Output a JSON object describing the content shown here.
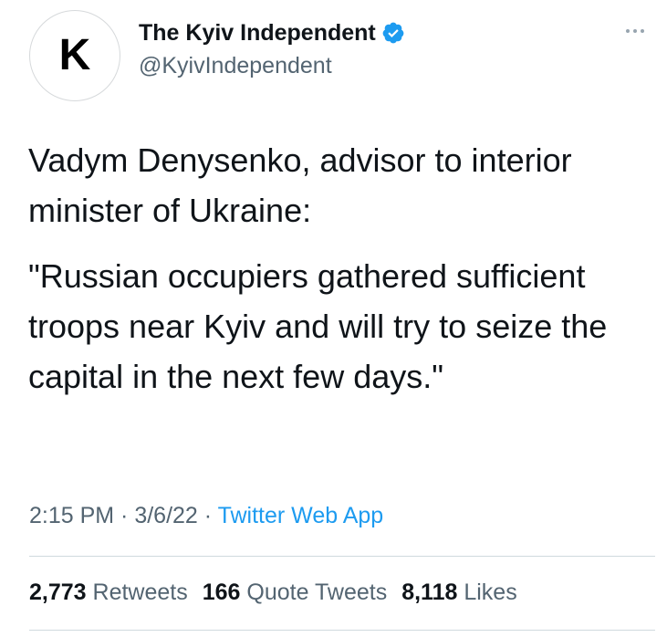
{
  "author": {
    "avatar_letter": "K",
    "display_name": "The Kyiv Independent",
    "verified": true,
    "handle": "@KyivIndependent"
  },
  "menu": {
    "icon": "more-horizontal-icon"
  },
  "tweet": {
    "paragraphs": [
      "Vadym Denysenko, advisor to interior minister of Ukraine:",
      "\"Russian occupiers gathered sufficient troops near Kyiv and will try to seize the capital in the next few days.\""
    ]
  },
  "meta": {
    "time": "2:15 PM",
    "separator1": " · ",
    "date": "3/6/22",
    "separator2": " · ",
    "source": "Twitter Web App"
  },
  "stats": {
    "retweets_count": "2,773",
    "retweets_label": "Retweets",
    "quote_tweets_count": "166",
    "quote_tweets_label": "Quote Tweets",
    "likes_count": "8,118",
    "likes_label": "Likes"
  },
  "colors": {
    "text_primary": "#0f1419",
    "text_secondary": "#536471",
    "link_blue": "#1d9bf0",
    "verified_blue": "#1d9bf0",
    "divider": "#cfd9de"
  }
}
